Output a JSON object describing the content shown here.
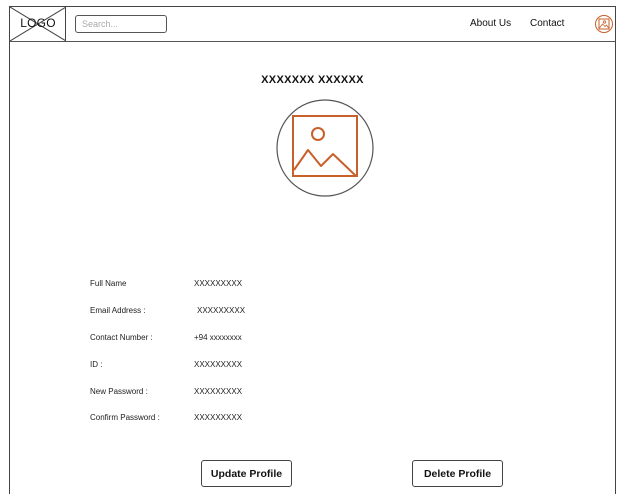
{
  "header": {
    "logo_label": "LOGO",
    "search_placeholder": "Search...",
    "nav": {
      "about": "About Us",
      "contact": "Contact"
    }
  },
  "profile": {
    "name": "XXXXXXX XXXXXX",
    "image_icon": "image-placeholder-icon",
    "accent_color": "#c8602a"
  },
  "fields": [
    {
      "label": "Full Name",
      "value": "XXXXXXXXX"
    },
    {
      "label": "Email Address :",
      "value": "XXXXXXXXX"
    },
    {
      "label": "Contact Number :",
      "value": "+94 xxxxxxxx"
    },
    {
      "label": "ID :",
      "value": "XXXXXXXXX"
    },
    {
      "label": "New Password :",
      "value": "XXXXXXXXX"
    },
    {
      "label": "Confirm Password :",
      "value": "XXXXXXXXX"
    }
  ],
  "actions": {
    "update": "Update Profile",
    "delete": "Delete Profile"
  }
}
